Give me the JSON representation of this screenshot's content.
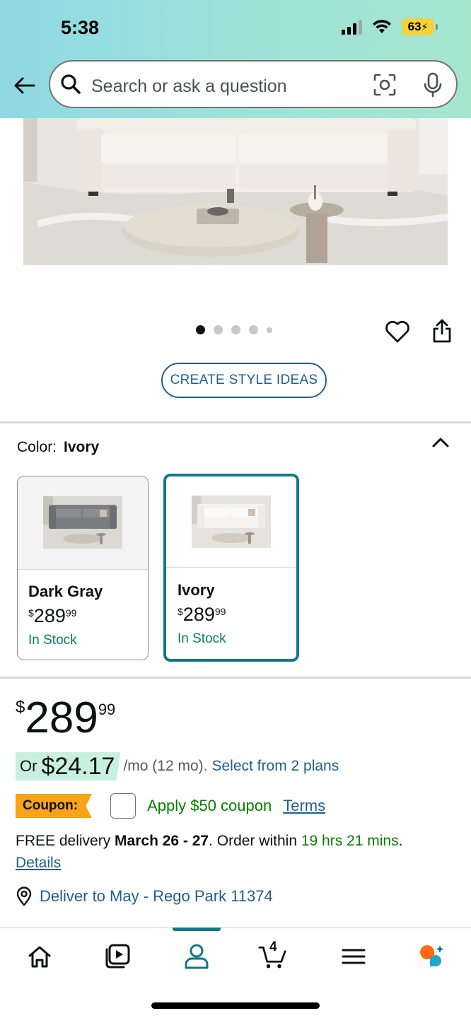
{
  "status_bar": {
    "time": "5:38",
    "battery": "63"
  },
  "search": {
    "placeholder": "Search or ask a question"
  },
  "gallery": {
    "dot_count": 5,
    "active_dot": 0
  },
  "style_ideas_button": "CREATE STYLE IDEAS",
  "color": {
    "label": "Color:",
    "selected": "Ivory",
    "options": [
      {
        "name": "Dark Gray",
        "currency": "$",
        "price": "289",
        "cents": "99",
        "stock": "In Stock"
      },
      {
        "name": "Ivory",
        "currency": "$",
        "price": "289",
        "cents": "99",
        "stock": "In Stock"
      }
    ]
  },
  "price": {
    "currency": "$",
    "whole": "289",
    "cents": "99"
  },
  "monthly": {
    "or": "Or",
    "amount": "$24.17",
    "term": "/mo (12 mo).",
    "link": "Select from 2 plans"
  },
  "coupon": {
    "tag": "Coupon:",
    "text": "Apply $50 coupon",
    "terms": "Terms"
  },
  "delivery": {
    "prefix": "FREE delivery ",
    "date": "March 26 - 27",
    "middle": ". Order within ",
    "countdown": "19 hrs 21 mins",
    "suffix": ".",
    "details": "Details"
  },
  "deliver_to": "Deliver to May - Rego Park 11374",
  "bottom_nav": {
    "cart_count": "4",
    "active": "profile"
  },
  "colors": {
    "link": "#1f5f8f",
    "selected_border": "#117887",
    "in_stock": "#067d62",
    "coupon_tag": "#f7a418",
    "coupon_text": "#067d00"
  }
}
